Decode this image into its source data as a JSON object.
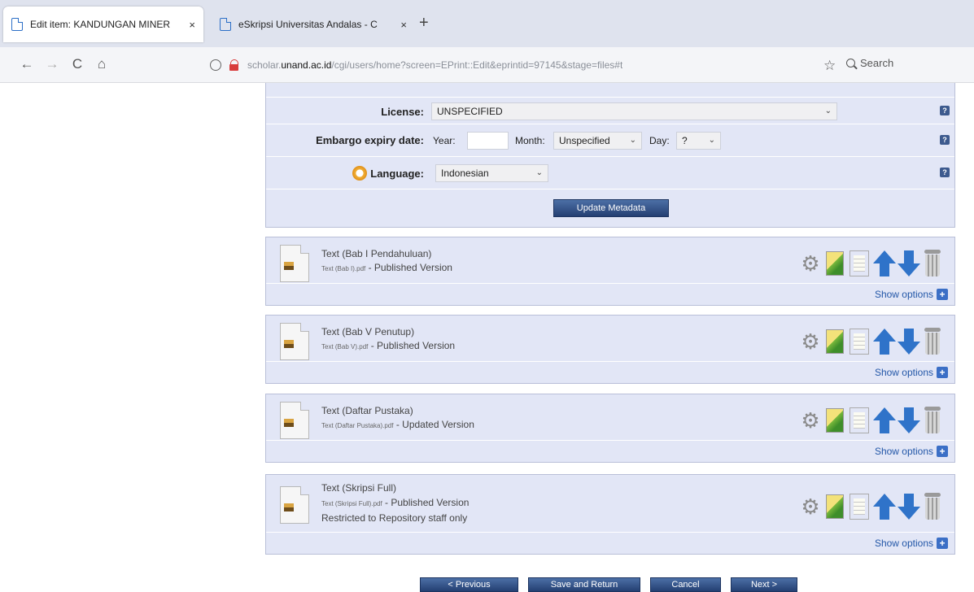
{
  "browser": {
    "tabs": [
      {
        "title": "Edit item: KANDUNGAN MINER",
        "close": "×"
      },
      {
        "title": "eSkripsi Universitas Andalas - C",
        "close": "×"
      }
    ],
    "new_tab": "+",
    "nav": {
      "back": "←",
      "forward": "→",
      "reload": "C",
      "home": "⌂"
    },
    "url_prefix": "scholar.",
    "url_domain": "unand.ac.id",
    "url_rest": "/cgi/users/home?screen=EPrint::Edit&eprintid=97145&stage=files#t",
    "star": "☆",
    "search_placeholder": "Search"
  },
  "metadata_form": {
    "license_label": "License:",
    "license_value": "UNSPECIFIED",
    "embargo_label": "Embargo expiry date:",
    "year_label": "Year:",
    "year_value": "",
    "month_label": "Month:",
    "month_value": "Unspecified",
    "day_label": "Day:",
    "day_value": "?",
    "language_label": "Language:",
    "language_value": "Indonesian",
    "update_button": "Update Metadata",
    "help_glyph": "?"
  },
  "files": [
    {
      "title": "Text (Bab I Pendahuluan)",
      "filename": "Text (Bab I).pdf",
      "version": " - Published Version",
      "note": "",
      "show_options": "Show options"
    },
    {
      "title": "Text (Bab V Penutup)",
      "filename": "Text (Bab V).pdf",
      "version": " - Published Version",
      "note": "",
      "show_options": "Show options"
    },
    {
      "title": "Text (Daftar Pustaka)",
      "filename": "Text (Daftar Pustaka).pdf",
      "version": " - Updated Version",
      "note": "",
      "show_options": "Show options"
    },
    {
      "title": "Text (Skripsi Full)",
      "filename": "Text (Skripsi Full).pdf",
      "version": " - Published Version",
      "note": "Restricted to Repository staff only",
      "show_options": "Show options"
    }
  ],
  "bottom_nav": {
    "previous": "< Previous",
    "save_return": "Save and Return",
    "cancel": "Cancel",
    "next": "Next >"
  }
}
